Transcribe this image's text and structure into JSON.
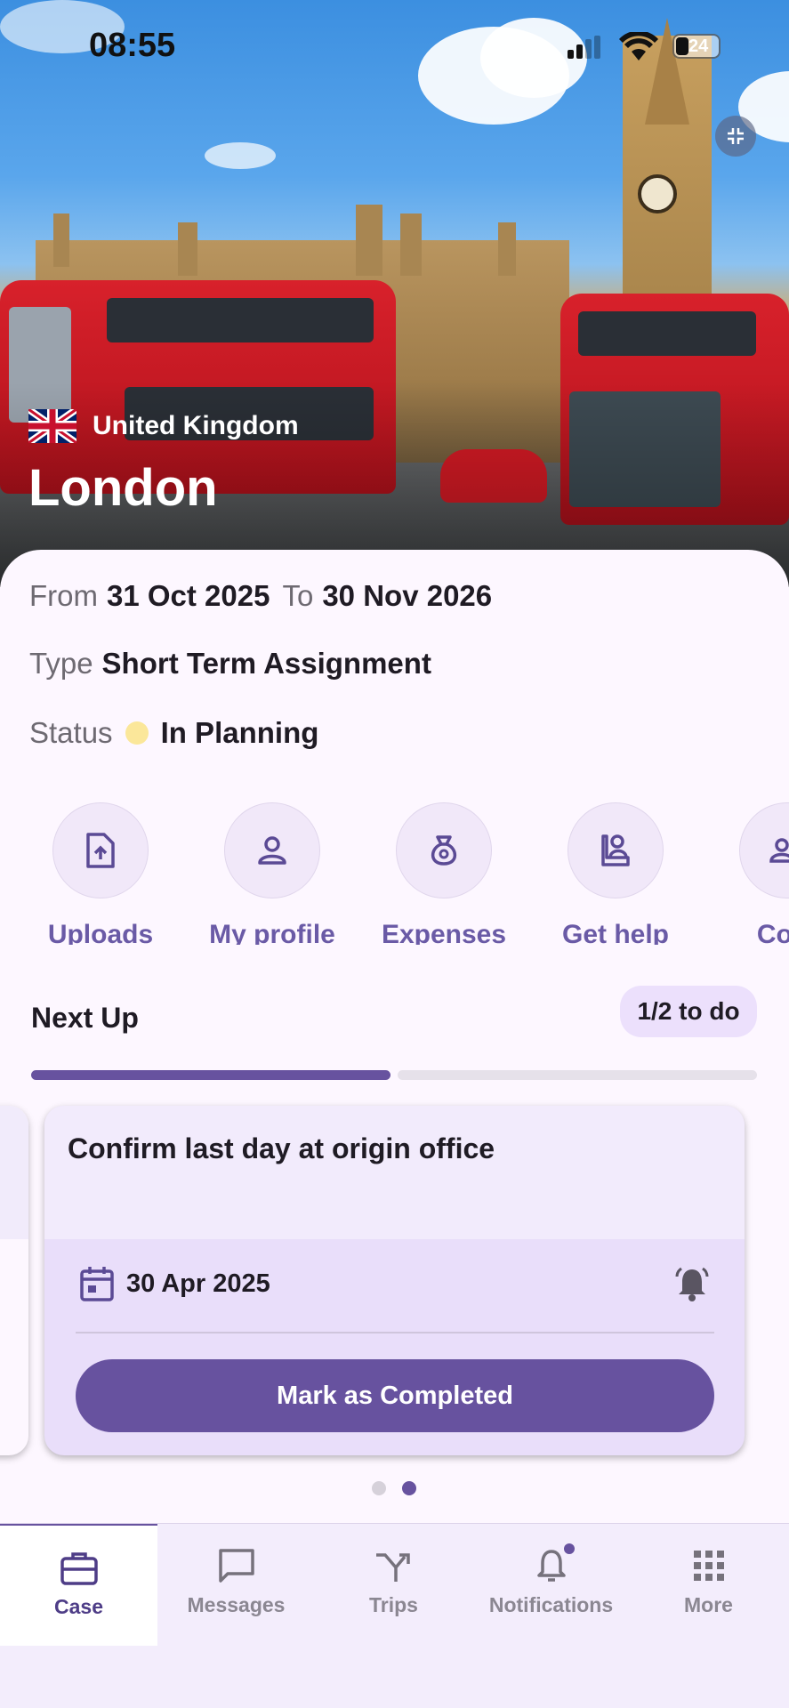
{
  "status_bar": {
    "time": "08:55",
    "battery": "24"
  },
  "hero": {
    "country": "United Kingdom",
    "city": "London"
  },
  "details": {
    "from_label": "From",
    "from_value": "31 Oct 2025",
    "to_label": "To",
    "to_value": "30 Nov 2026",
    "type_label": "Type",
    "type_value": "Short Term Assignment",
    "status_label": "Status",
    "status_value": "In Planning",
    "status_color": "#fbe79a"
  },
  "quick_actions": [
    {
      "label": "Uploads",
      "icon": "upload-file-icon"
    },
    {
      "label": "My profile",
      "icon": "person-icon"
    },
    {
      "label": "Expenses",
      "icon": "money-bag-icon"
    },
    {
      "label": "Get help",
      "icon": "support-agent-icon"
    },
    {
      "label": "Cont",
      "icon": "contacts-icon"
    }
  ],
  "next_up": {
    "title": "Next Up",
    "todo_badge": "1/2 to do",
    "progress": 0.5,
    "card": {
      "title": "Confirm last day at origin office",
      "date": "30 Apr 2025",
      "button": "Mark as Completed"
    },
    "page_count": 2,
    "active_page": 2
  },
  "bottom_nav": [
    {
      "label": "Case",
      "icon": "briefcase-icon",
      "active": true
    },
    {
      "label": "Messages",
      "icon": "chat-icon",
      "active": false
    },
    {
      "label": "Trips",
      "icon": "route-icon",
      "active": false
    },
    {
      "label": "Notifications",
      "icon": "bell-icon",
      "active": false
    },
    {
      "label": "More",
      "icon": "grid-icon",
      "active": false
    }
  ],
  "colors": {
    "accent": "#67529f",
    "accent_text": "#6a5aa6",
    "sheet_bg": "#fdf7ff"
  }
}
